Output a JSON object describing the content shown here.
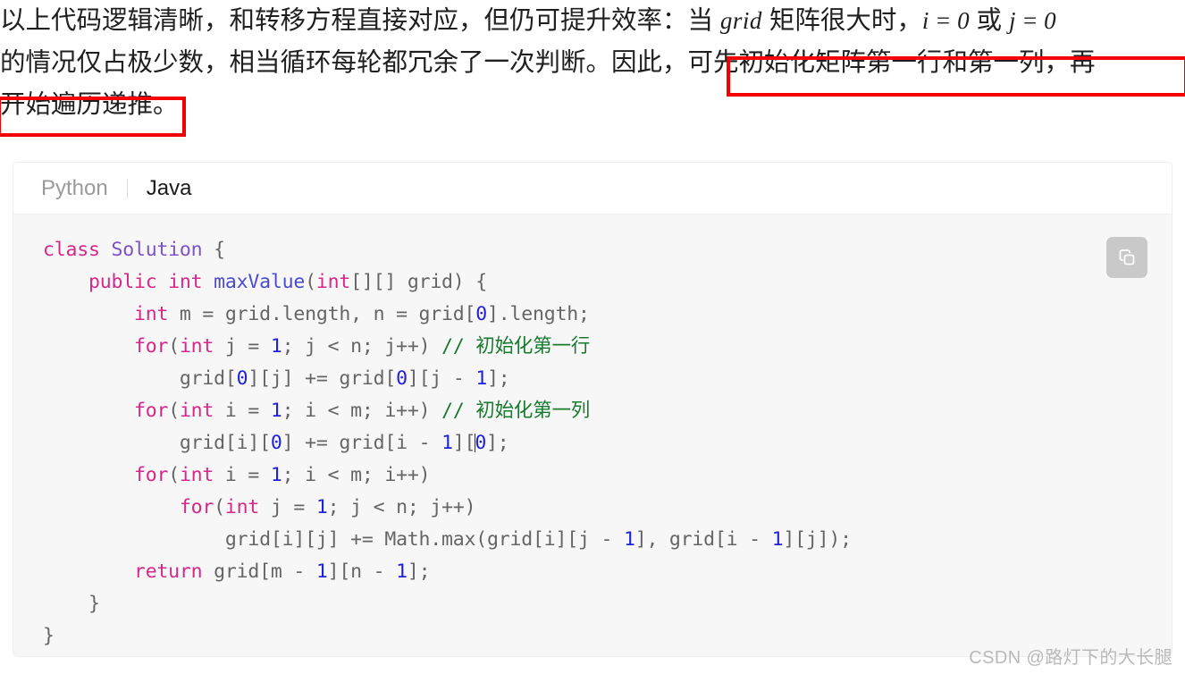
{
  "prose": {
    "line1_part1": "以上代码逻辑清晰，和转移方程直接对应，但仍可提升效率：当 ",
    "line1_math1": "grid",
    "line1_part2": " 矩阵很大时，",
    "line1_math2": "i = 0",
    "line1_part3": " 或 ",
    "line1_math3": "j = 0",
    "line2_part1": "的情况仅占极少数，相当循环每轮都冗余了一次判断。因此，",
    "line2_highlight": "可先初始化矩阵第一行和第一列，再",
    "line3_highlight": "开始遍历递推。"
  },
  "annotations": {
    "box_color": "#f40000"
  },
  "code_card": {
    "tabs": [
      {
        "label": "Python",
        "active": false
      },
      {
        "label": "Java",
        "active": true
      }
    ],
    "copy_button": {
      "icon": "copy-icon",
      "background": "#c9c9c9"
    },
    "language": "Java",
    "code_lines": [
      [
        {
          "t": "class ",
          "c": "kw"
        },
        {
          "t": "Solution",
          "c": "ty"
        },
        {
          "t": " {",
          "c": "pl"
        }
      ],
      [
        {
          "t": "    ",
          "c": "pl"
        },
        {
          "t": "public int ",
          "c": "kw"
        },
        {
          "t": "maxValue",
          "c": "fn"
        },
        {
          "t": "(",
          "c": "pl"
        },
        {
          "t": "int",
          "c": "kw"
        },
        {
          "t": "[][] grid) {",
          "c": "pl"
        }
      ],
      [
        {
          "t": "        ",
          "c": "pl"
        },
        {
          "t": "int",
          "c": "kw"
        },
        {
          "t": " m = grid.length, n = grid[",
          "c": "pl"
        },
        {
          "t": "0",
          "c": "num"
        },
        {
          "t": "].length;",
          "c": "pl"
        }
      ],
      [
        {
          "t": "        ",
          "c": "pl"
        },
        {
          "t": "for",
          "c": "kw"
        },
        {
          "t": "(",
          "c": "pl"
        },
        {
          "t": "int",
          "c": "kw"
        },
        {
          "t": " j = ",
          "c": "pl"
        },
        {
          "t": "1",
          "c": "num"
        },
        {
          "t": "; j < n; j++) ",
          "c": "pl"
        },
        {
          "t": "// 初始化第一行",
          "c": "cm"
        }
      ],
      [
        {
          "t": "            grid[",
          "c": "pl"
        },
        {
          "t": "0",
          "c": "num"
        },
        {
          "t": "][j] += grid[",
          "c": "pl"
        },
        {
          "t": "0",
          "c": "num"
        },
        {
          "t": "][j - ",
          "c": "pl"
        },
        {
          "t": "1",
          "c": "num"
        },
        {
          "t": "];",
          "c": "pl"
        }
      ],
      [
        {
          "t": "        ",
          "c": "pl"
        },
        {
          "t": "for",
          "c": "kw"
        },
        {
          "t": "(",
          "c": "pl"
        },
        {
          "t": "int",
          "c": "kw"
        },
        {
          "t": " i = ",
          "c": "pl"
        },
        {
          "t": "1",
          "c": "num"
        },
        {
          "t": "; i < m; i++) ",
          "c": "pl"
        },
        {
          "t": "// 初始化第一列",
          "c": "cm"
        }
      ],
      [
        {
          "t": "            grid[i][",
          "c": "pl"
        },
        {
          "t": "0",
          "c": "num"
        },
        {
          "t": "] += grid[i - ",
          "c": "pl"
        },
        {
          "t": "1",
          "c": "num"
        },
        {
          "t": "][",
          "c": "pl"
        },
        {
          "t": "|",
          "c": "caret"
        },
        {
          "t": "0",
          "c": "num"
        },
        {
          "t": "];",
          "c": "pl"
        }
      ],
      [
        {
          "t": "        ",
          "c": "pl"
        },
        {
          "t": "for",
          "c": "kw"
        },
        {
          "t": "(",
          "c": "pl"
        },
        {
          "t": "int",
          "c": "kw"
        },
        {
          "t": " i = ",
          "c": "pl"
        },
        {
          "t": "1",
          "c": "num"
        },
        {
          "t": "; i < m; i++)",
          "c": "pl"
        }
      ],
      [
        {
          "t": "            ",
          "c": "pl"
        },
        {
          "t": "for",
          "c": "kw"
        },
        {
          "t": "(",
          "c": "pl"
        },
        {
          "t": "int",
          "c": "kw"
        },
        {
          "t": " j = ",
          "c": "pl"
        },
        {
          "t": "1",
          "c": "num"
        },
        {
          "t": "; j < n; j++)",
          "c": "pl"
        }
      ],
      [
        {
          "t": "                grid[i][j] += Math.max(grid[i][j - ",
          "c": "pl"
        },
        {
          "t": "1",
          "c": "num"
        },
        {
          "t": "], grid[i - ",
          "c": "pl"
        },
        {
          "t": "1",
          "c": "num"
        },
        {
          "t": "][j]);",
          "c": "pl"
        }
      ],
      [
        {
          "t": "        ",
          "c": "pl"
        },
        {
          "t": "return",
          "c": "kw"
        },
        {
          "t": " grid[m - ",
          "c": "pl"
        },
        {
          "t": "1",
          "c": "num"
        },
        {
          "t": "][n - ",
          "c": "pl"
        },
        {
          "t": "1",
          "c": "num"
        },
        {
          "t": "];",
          "c": "pl"
        }
      ],
      [
        {
          "t": "    }",
          "c": "pl"
        }
      ],
      [
        {
          "t": "}",
          "c": "pl"
        }
      ]
    ],
    "syntax_colors": {
      "keyword": "#d5288a",
      "type": "#7b52c9",
      "function": "#4a4ad0",
      "number": "#2020dd",
      "comment": "#1a7a30",
      "plain": "#656565",
      "background": "#f7f7f7"
    }
  },
  "watermark": {
    "text": "CSDN @路灯下的大长腿"
  }
}
